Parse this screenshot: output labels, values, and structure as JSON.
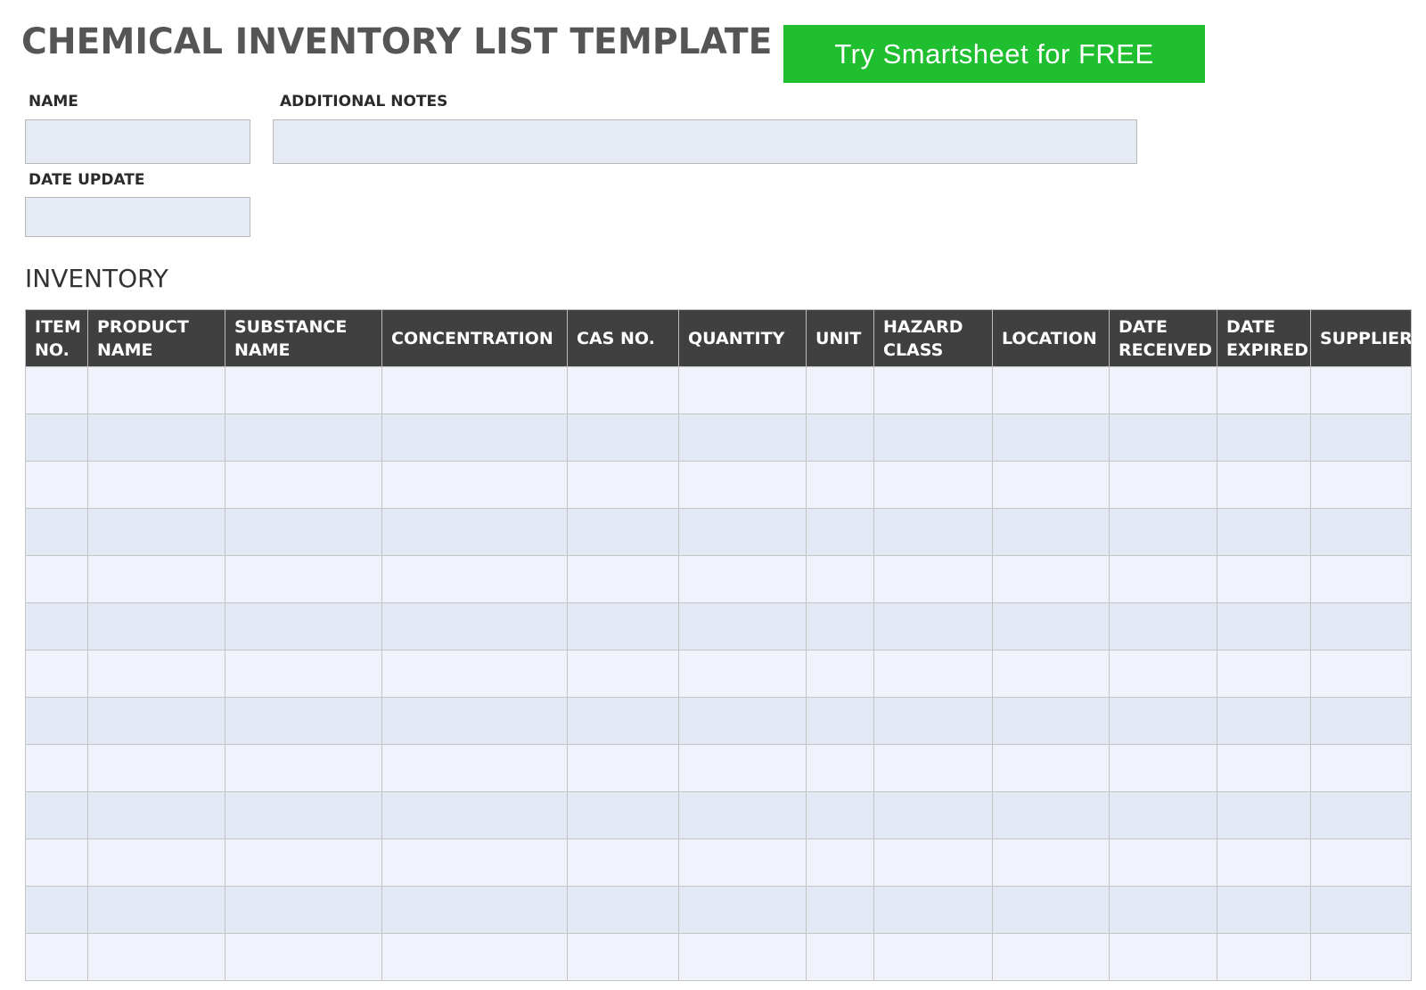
{
  "title": "CHEMICAL INVENTORY LIST TEMPLATE",
  "cta": {
    "label": "Try Smartsheet for FREE",
    "color": "#1fbf2f"
  },
  "fields": {
    "name": {
      "label": "NAME",
      "value": ""
    },
    "additional_notes": {
      "label": "ADDITIONAL NOTES",
      "value": ""
    },
    "date_update": {
      "label": "DATE UPDATE",
      "value": ""
    }
  },
  "inventory": {
    "title": "INVENTORY",
    "header_bg": "#404040",
    "columns": [
      {
        "key": "item_no",
        "label": "ITEM\nNO."
      },
      {
        "key": "product_name",
        "label": "PRODUCT\nNAME"
      },
      {
        "key": "substance_name",
        "label": "SUBSTANCE\nNAME"
      },
      {
        "key": "concentration",
        "label": "CONCENTRATION"
      },
      {
        "key": "cas_no",
        "label": "CAS NO."
      },
      {
        "key": "quantity",
        "label": "QUANTITY"
      },
      {
        "key": "unit",
        "label": "UNIT"
      },
      {
        "key": "hazard_class",
        "label": "HAZARD\nCLASS"
      },
      {
        "key": "location",
        "label": "LOCATION"
      },
      {
        "key": "date_received",
        "label": "DATE\nRECEIVED"
      },
      {
        "key": "date_expired",
        "label": "DATE\nEXPIRED"
      },
      {
        "key": "supplier",
        "label": "SUPPLIER"
      }
    ],
    "rows": [
      [
        "",
        "",
        "",
        "",
        "",
        "",
        "",
        "",
        "",
        "",
        "",
        ""
      ],
      [
        "",
        "",
        "",
        "",
        "",
        "",
        "",
        "",
        "",
        "",
        "",
        ""
      ],
      [
        "",
        "",
        "",
        "",
        "",
        "",
        "",
        "",
        "",
        "",
        "",
        ""
      ],
      [
        "",
        "",
        "",
        "",
        "",
        "",
        "",
        "",
        "",
        "",
        "",
        ""
      ],
      [
        "",
        "",
        "",
        "",
        "",
        "",
        "",
        "",
        "",
        "",
        "",
        ""
      ],
      [
        "",
        "",
        "",
        "",
        "",
        "",
        "",
        "",
        "",
        "",
        "",
        ""
      ],
      [
        "",
        "",
        "",
        "",
        "",
        "",
        "",
        "",
        "",
        "",
        "",
        ""
      ],
      [
        "",
        "",
        "",
        "",
        "",
        "",
        "",
        "",
        "",
        "",
        "",
        ""
      ],
      [
        "",
        "",
        "",
        "",
        "",
        "",
        "",
        "",
        "",
        "",
        "",
        ""
      ],
      [
        "",
        "",
        "",
        "",
        "",
        "",
        "",
        "",
        "",
        "",
        "",
        ""
      ],
      [
        "",
        "",
        "",
        "",
        "",
        "",
        "",
        "",
        "",
        "",
        "",
        ""
      ],
      [
        "",
        "",
        "",
        "",
        "",
        "",
        "",
        "",
        "",
        "",
        "",
        ""
      ],
      [
        "",
        "",
        "",
        "",
        "",
        "",
        "",
        "",
        "",
        "",
        "",
        ""
      ]
    ]
  }
}
